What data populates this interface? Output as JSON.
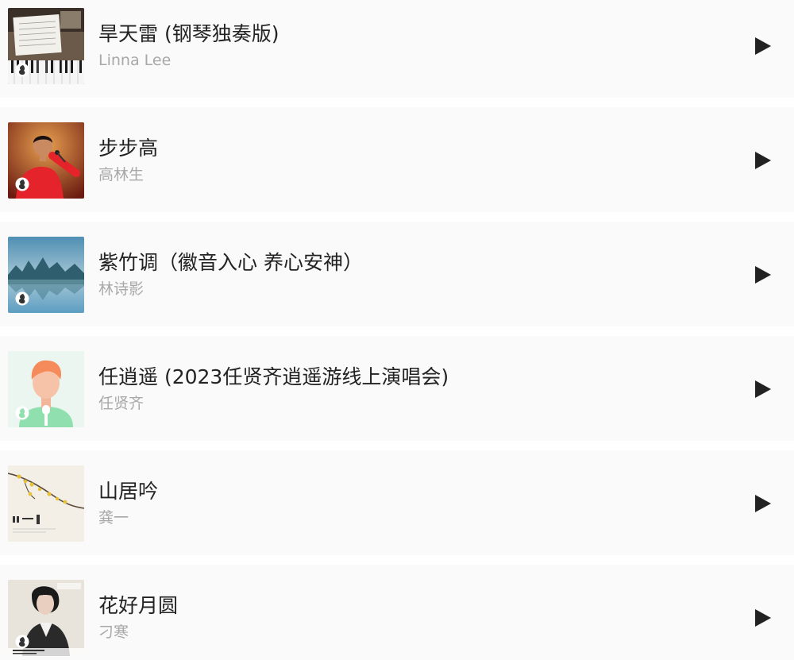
{
  "songs": [
    {
      "title": "旱天雷 (钢琴独奏版)",
      "artist": "Linna Lee",
      "cover": "piano"
    },
    {
      "title": "步步高",
      "artist": "高林生",
      "cover": "singer-red"
    },
    {
      "title": "紫竹调（徽音入心 养心安神）",
      "artist": "林诗影",
      "cover": "lake"
    },
    {
      "title": "任逍遥 (2023任贤齐逍遥游线上演唱会)",
      "artist": "任贤齐",
      "cover": "avatar"
    },
    {
      "title": "山居吟",
      "artist": "龚一",
      "cover": "plum"
    },
    {
      "title": "花好月圆",
      "artist": "刁寒",
      "cover": "portrait"
    }
  ],
  "colors": {
    "row_bg": "#fafafa",
    "title": "#222222",
    "artist": "#a8a8a8",
    "play_icon": "#222222"
  },
  "icons": {
    "play": "play-triangle-icon",
    "badge": "music-platform-badge-icon"
  }
}
